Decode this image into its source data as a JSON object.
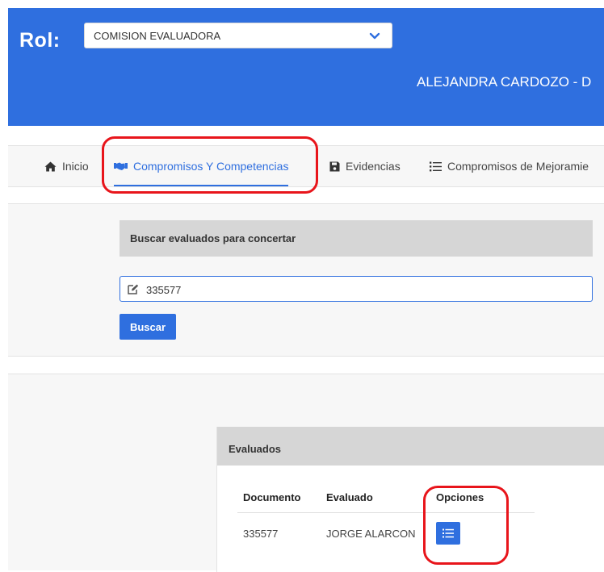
{
  "header": {
    "rol_label": "Rol:",
    "role_selected": "COMISION EVALUADORA",
    "user_name": "ALEJANDRA CARDOZO - D",
    "color": "#2f6fdf"
  },
  "nav": {
    "items": [
      {
        "label": "Inicio",
        "icon": "home-icon"
      },
      {
        "label": "Compromisos Y Competencias",
        "icon": "handshake-icon",
        "active": true
      },
      {
        "label": "Evidencias",
        "icon": "save-icon"
      },
      {
        "label": "Compromisos de Mejoramie",
        "icon": "list-icon"
      }
    ]
  },
  "search": {
    "title": "Buscar evaluados para concertar",
    "value": "335577",
    "button": "Buscar"
  },
  "results": {
    "title": "Evaluados",
    "columns": [
      "Documento",
      "Evaluado",
      "Opciones"
    ],
    "rows": [
      {
        "documento": "335577",
        "evaluado": "JORGE ALARCON"
      }
    ]
  },
  "colors": {
    "accent": "#2f6fdf",
    "highlight": "#e8151b",
    "panel": "#f7f7f7",
    "panel_header": "#d6d6d6"
  }
}
